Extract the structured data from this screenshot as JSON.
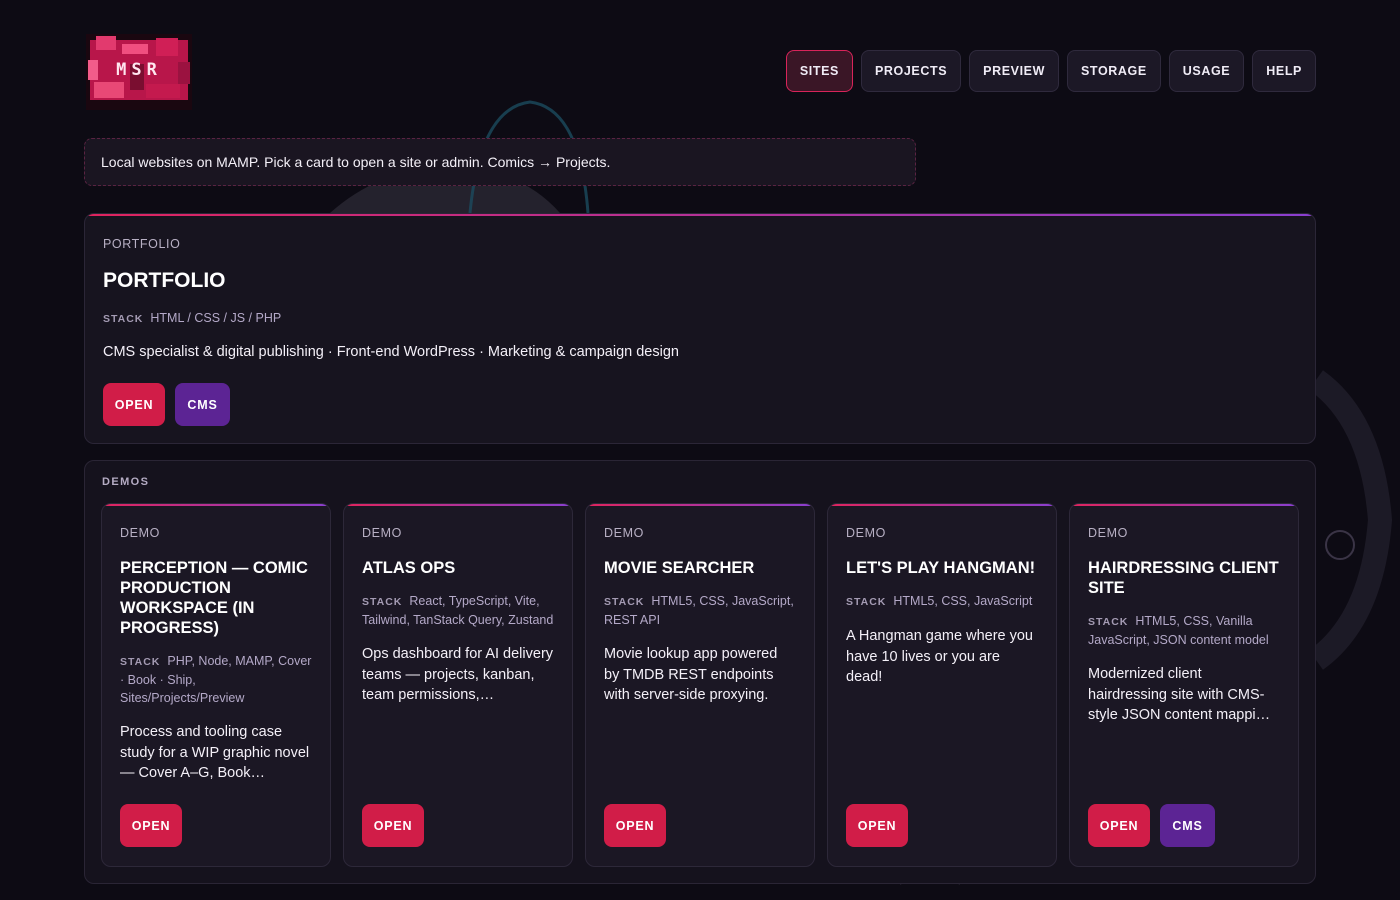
{
  "brand": {
    "logo_text": "MSR"
  },
  "nav": [
    {
      "label": "SITES",
      "active": true
    },
    {
      "label": "PROJECTS"
    },
    {
      "label": "PREVIEW"
    },
    {
      "label": "STORAGE"
    },
    {
      "label": "USAGE"
    },
    {
      "label": "HELP"
    }
  ],
  "notice": "Local websites on MAMP. Pick a card to open a site or admin. Comics → Projects.",
  "portfolio": {
    "kicker": "PORTFOLIO",
    "title": "PORTFOLIO",
    "stack_label": "STACK",
    "stack": "HTML / CSS / JS / PHP",
    "description": "CMS specialist & digital publishing · Front-end WordPress · Marketing & campaign design",
    "open_label": "OPEN",
    "cms_label": "CMS"
  },
  "demos": {
    "label": "DEMOS",
    "cards": [
      {
        "kicker": "DEMO",
        "title": "PERCEPTION — COMIC PRODUCTION WORKSPACE (IN PROGRESS)",
        "stack_label": "STACK",
        "stack": "PHP, Node, MAMP, Cover · Book · Ship, Sites/Projects/Preview",
        "description": "Process and tooling case study for a WIP graphic novel — Cover A–G, Book…",
        "open_label": "OPEN"
      },
      {
        "kicker": "DEMO",
        "title": "ATLAS OPS",
        "stack_label": "STACK",
        "stack": "React, TypeScript, Vite, Tailwind, TanStack Query, Zustand",
        "description": "Ops dashboard for AI delivery teams — projects, kanban, team permissions,…",
        "open_label": "OPEN"
      },
      {
        "kicker": "DEMO",
        "title": "MOVIE SEARCHER",
        "stack_label": "STACK",
        "stack": "HTML5, CSS, JavaScript, REST API",
        "description": "Movie lookup app powered by TMDB REST endpoints with server-side proxying.",
        "open_label": "OPEN"
      },
      {
        "kicker": "DEMO",
        "title": "LET'S PLAY HANGMAN!",
        "stack_label": "STACK",
        "stack": "HTML5, CSS, JavaScript",
        "description": "A Hangman game where you have 10 lives or you are dead!",
        "open_label": "OPEN"
      },
      {
        "kicker": "DEMO",
        "title": "HAIRDRESSING CLIENT SITE",
        "stack_label": "STACK",
        "stack": "HTML5, CSS, Vanilla JavaScript, JSON content model",
        "description": "Modernized client hairdressing site with CMS-style JSON content mappi…",
        "open_label": "OPEN",
        "cms_label": "CMS"
      }
    ]
  },
  "colors": {
    "background": "#0d0b14",
    "accent_red": "#d11d48",
    "accent_purple": "#5c2494",
    "active_nav_border": "#d8245a"
  }
}
